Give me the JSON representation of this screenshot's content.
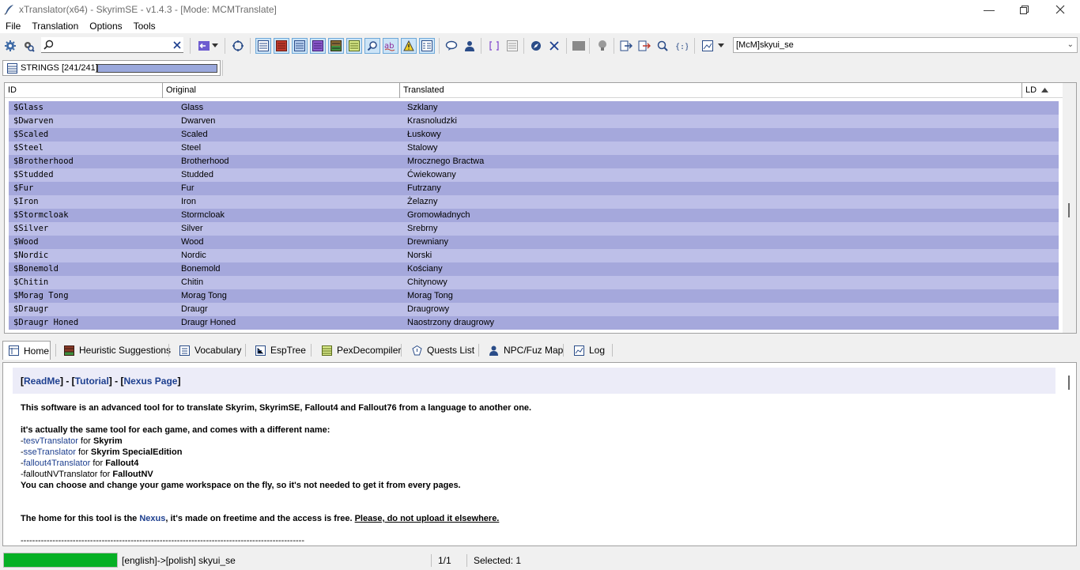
{
  "window": {
    "title": "xTranslator(x64) - SkyrimSE - v1.4.3 - [Mode: MCMTranslate]"
  },
  "menu": [
    "File",
    "Translation",
    "Options",
    "Tools"
  ],
  "toolbar": {
    "search_value": "",
    "profile_value": "[McM]skyui_se"
  },
  "strings_tab": {
    "label": "STRINGS [241/241]",
    "progress": 1.0
  },
  "grid": {
    "columns": [
      "ID",
      "Original",
      "Translated",
      "LD"
    ],
    "rows": [
      {
        "id": "$Glass",
        "original": "Glass",
        "translated": "Szklany"
      },
      {
        "id": "$Dwarven",
        "original": "Dwarven",
        "translated": "Krasnoludzki"
      },
      {
        "id": "$Scaled",
        "original": "Scaled",
        "translated": "Łuskowy"
      },
      {
        "id": "$Steel",
        "original": "Steel",
        "translated": "Stalowy"
      },
      {
        "id": "$Brotherhood",
        "original": "Brotherhood",
        "translated": "Mrocznego Bractwa"
      },
      {
        "id": "$Studded",
        "original": "Studded",
        "translated": "Ćwiekowany"
      },
      {
        "id": "$Fur",
        "original": "Fur",
        "translated": "Futrzany"
      },
      {
        "id": "$Iron",
        "original": "Iron",
        "translated": "Żelazny"
      },
      {
        "id": "$Stormcloak",
        "original": "Stormcloak",
        "translated": "Gromowładnych"
      },
      {
        "id": "$Silver",
        "original": "Silver",
        "translated": "Srebrny"
      },
      {
        "id": "$Wood",
        "original": "Wood",
        "translated": "Drewniany"
      },
      {
        "id": "$Nordic",
        "original": "Nordic",
        "translated": "Norski"
      },
      {
        "id": "$Bonemold",
        "original": "Bonemold",
        "translated": "Kościany"
      },
      {
        "id": "$Chitin",
        "original": "Chitin",
        "translated": "Chitynowy"
      },
      {
        "id": "$Morag Tong",
        "original": "Morag Tong",
        "translated": "Morag Tong"
      },
      {
        "id": "$Draugr",
        "original": "Draugr",
        "translated": "Draugrowy"
      },
      {
        "id": "$Draugr Honed",
        "original": "Draugr Honed",
        "translated": "Naostrzony draugrowy"
      }
    ]
  },
  "bottom_tabs": [
    {
      "label": "Home",
      "icon": "home-icon"
    },
    {
      "label": "Heuristic Suggestions",
      "icon": "heuristic-icon"
    },
    {
      "label": "Vocabulary",
      "icon": "vocabulary-icon"
    },
    {
      "label": "EspTree",
      "icon": "esptree-icon"
    },
    {
      "label": "PexDecompiler",
      "icon": "pex-icon"
    },
    {
      "label": "Quests List",
      "icon": "quests-icon"
    },
    {
      "label": "NPC/Fuz Map",
      "icon": "npc-icon"
    },
    {
      "label": "Log",
      "icon": "log-icon"
    }
  ],
  "home": {
    "links": [
      "ReadMe",
      "Tutorial",
      "Nexus Page"
    ],
    "intro": "This software is an advanced tool for to translate Skyrim, SkyrimSE, Fallout4 and Fallout76 from a language to another one.",
    "same_tool": "it's actually the same tool for each game, and comes with a different name:",
    "variants": [
      {
        "name": "tesvTranslator",
        "for": "for",
        "game": "Skyrim"
      },
      {
        "name": "sseTranslator",
        "for": "for",
        "game": "Skyrim SpecialEdition"
      },
      {
        "name": "fallout4Translator",
        "for": "for",
        "game": "Fallout4"
      },
      {
        "name": "falloutNVTranslator",
        "for": "for",
        "game": "FalloutNV"
      }
    ],
    "workspace": "You can choose and change your game workspace on the fly, so it's not needed to get it from every pages.",
    "home_pre": "The home for this tool is the",
    "home_link": "Nexus",
    "home_post": ", it's made on freetime and the access is free.",
    "warning": "Please, do not upload it elsewhere.",
    "divider": "--------------------------------------------------------------------------------------------------"
  },
  "status": {
    "progress": 1.0,
    "language": "[english]->[polish] skyui_se",
    "count": "1/1",
    "selected": "Selected: 1"
  },
  "colors": {
    "row_odd": "#a5a8dc",
    "row_even": "#bdbfe8",
    "link": "#1d3f8f",
    "status_progress": "#06b025"
  }
}
